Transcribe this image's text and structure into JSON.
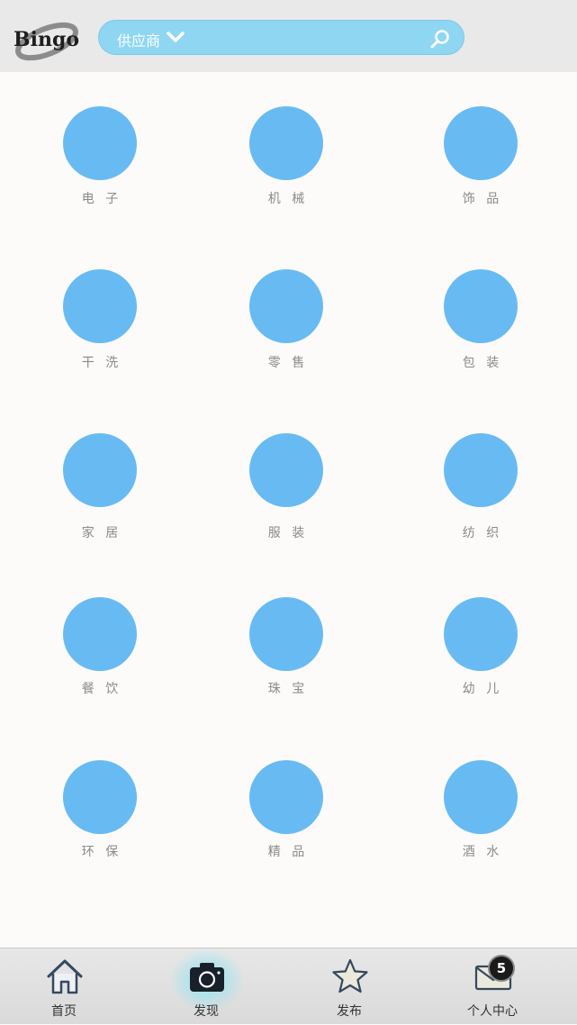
{
  "header": {
    "logo_text": "Bingo",
    "search": {
      "category_label": "供应商"
    }
  },
  "categories": [
    {
      "label": "电 子"
    },
    {
      "label": "机 械"
    },
    {
      "label": "饰 品"
    },
    {
      "label": "干 洗"
    },
    {
      "label": "零 售"
    },
    {
      "label": "包 装"
    },
    {
      "label": "家 居"
    },
    {
      "label": "服 装"
    },
    {
      "label": "纺 织"
    },
    {
      "label": "餐 饮"
    },
    {
      "label": "珠 宝"
    },
    {
      "label": "幼 儿"
    },
    {
      "label": "环 保"
    },
    {
      "label": "精 品"
    },
    {
      "label": "酒 水"
    }
  ],
  "tabbar": {
    "tabs": [
      {
        "label": "首页",
        "icon": "home-icon"
      },
      {
        "label": "发现",
        "icon": "camera-icon",
        "active": true
      },
      {
        "label": "发布",
        "icon": "star-icon"
      },
      {
        "label": "个人中心",
        "icon": "mail-icon"
      }
    ],
    "badge": "5"
  },
  "colors": {
    "header_bg": "#e9e9e9",
    "search_bg": "#8fd6f3",
    "category_circle": "#68bbf2",
    "label_text": "#8a8a8a"
  }
}
